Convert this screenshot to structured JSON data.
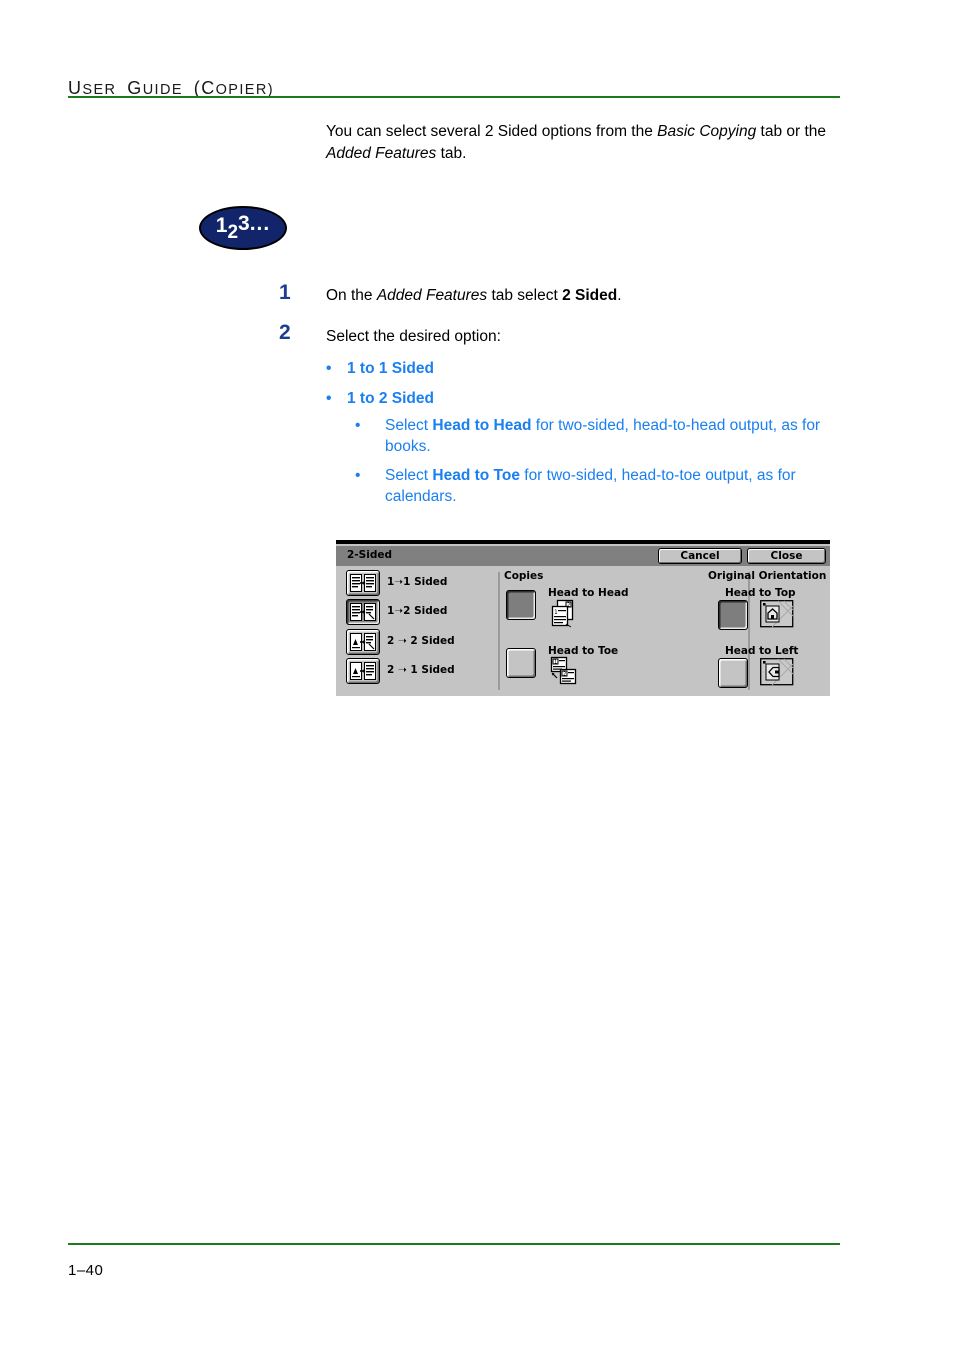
{
  "header": {
    "title_parts": [
      {
        "cap": "U",
        "rest": "SER"
      },
      {
        "cap": "G",
        "rest": "UIDE"
      },
      {
        "cap": "(C",
        "rest": "OPIER)"
      }
    ],
    "title_plain": "USER GUIDE (COPIER)",
    "rule_color": "#1d7a1d"
  },
  "intro": {
    "line1_a": "You can select several 2 Sided options from the ",
    "line1_italic": "Basic Copying",
    "line1_b": " tab",
    "line2_a": "or the ",
    "line2_italic": "Added Features",
    "line2_b": " tab."
  },
  "badge": {
    "d1": "1",
    "d2": "2",
    "d3": "3",
    "dots": "...",
    "fill_color": "#12256b"
  },
  "steps": [
    {
      "num": "1",
      "text_a": "On the ",
      "italic": "Added Features",
      "text_b": " tab select ",
      "bold": "2 Sided",
      "text_c": "."
    },
    {
      "num": "2",
      "text_a": "Select the desired option:",
      "italic": "",
      "text_b": "",
      "bold": "",
      "text_c": ""
    }
  ],
  "bullets_level1": [
    {
      "dot": "•",
      "label": "1 to 1 Sided"
    },
    {
      "dot": "•",
      "label": "1 to 2 Sided"
    }
  ],
  "bullets_level2": [
    {
      "dot": "•",
      "text_a": "Select ",
      "bold": "Head to Head",
      "text_b": " for two-sided, head-to-head output, as for books."
    },
    {
      "dot": "•",
      "text_a": "Select ",
      "bold": "Head to Toe",
      "text_b": " for two-sided, head-to-toe output, as for calendars."
    }
  ],
  "colors": {
    "link_blue": "#1a7ff0",
    "step_navy": "#1b3f8f",
    "rule_green": "#1d7a1d",
    "dialog_face": "#c4c4c4",
    "dialog_titlebar": "#808080"
  },
  "dialog": {
    "title": "2-Sided",
    "buttons": {
      "cancel": "Cancel",
      "close": "Close"
    },
    "sided_options": [
      {
        "label": "1➝1 Sided",
        "selected": false,
        "icon": "one-to-one-sided-icon"
      },
      {
        "label": "1➝2 Sided",
        "selected": true,
        "icon": "one-to-two-sided-icon"
      },
      {
        "label": "2 ➝ 2 Sided",
        "selected": false,
        "icon": "two-to-two-sided-icon"
      },
      {
        "label": "2 ➝ 1 Sided",
        "selected": false,
        "icon": "two-to-one-sided-icon"
      }
    ],
    "copies": {
      "group_title": "Copies",
      "items": [
        {
          "label": "Head to Head",
          "selected": true,
          "icon": "head-to-head-icon"
        },
        {
          "label": "Head to Toe",
          "selected": false,
          "icon": "head-to-toe-icon"
        }
      ]
    },
    "orientation": {
      "group_title": "Original Orientation",
      "items": [
        {
          "label": "Head to Top",
          "selected": true,
          "icon": "head-to-top-icon"
        },
        {
          "label": "Head to Left",
          "selected": false,
          "icon": "head-to-left-icon"
        }
      ]
    }
  },
  "footer": {
    "page_number": "1–40"
  }
}
